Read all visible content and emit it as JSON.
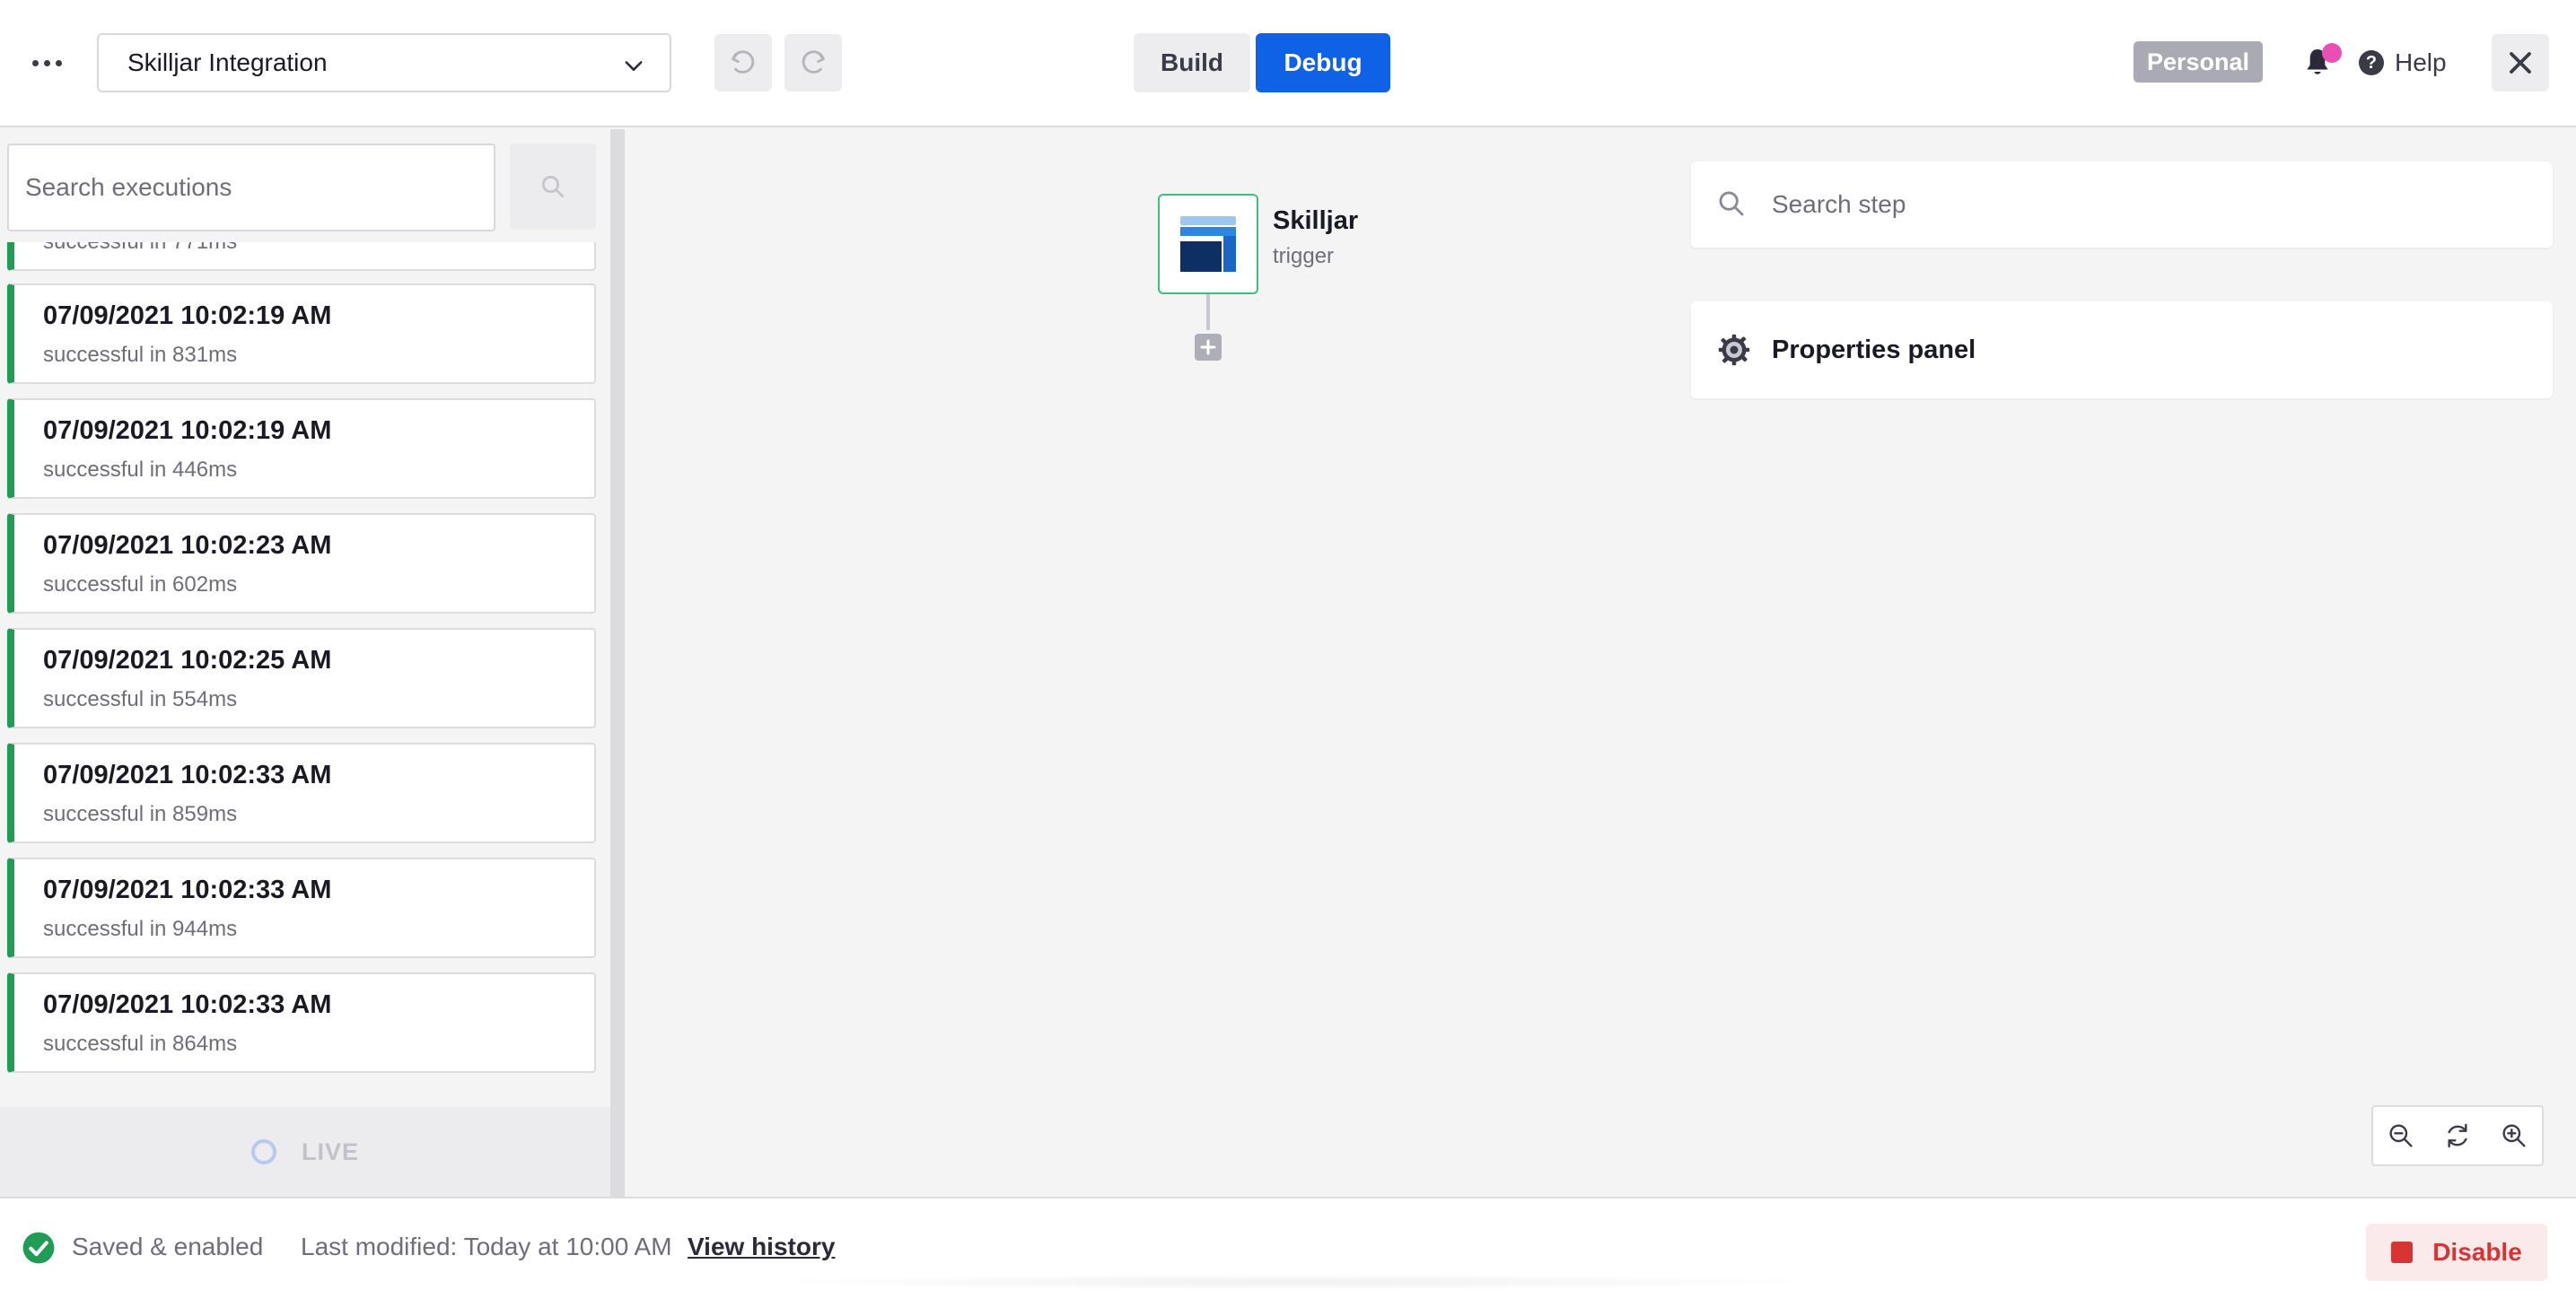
{
  "header": {
    "flow_name": "Skilljar Integration",
    "tabs": [
      {
        "label": "Build",
        "active": false
      },
      {
        "label": "Debug",
        "active": true
      }
    ],
    "workspace_badge": "Personal",
    "help_label": "Help",
    "notification_badge_color": "#ea4fb6",
    "accent_color": "#0f62e6"
  },
  "executions": {
    "search_placeholder": "Search executions",
    "partial_item_text": "successful in 771ms",
    "items": [
      {
        "time": "07/09/2021 10:02:19 AM",
        "status": "successful in 831ms"
      },
      {
        "time": "07/09/2021 10:02:19 AM",
        "status": "successful in 446ms"
      },
      {
        "time": "07/09/2021 10:02:23 AM",
        "status": "successful in 602ms"
      },
      {
        "time": "07/09/2021 10:02:25 AM",
        "status": "successful in 554ms"
      },
      {
        "time": "07/09/2021 10:02:33 AM",
        "status": "successful in 859ms"
      },
      {
        "time": "07/09/2021 10:02:33 AM",
        "status": "successful in 944ms"
      },
      {
        "time": "07/09/2021 10:02:33 AM",
        "status": "successful in 864ms"
      }
    ],
    "success_color": "#1f9d55",
    "live_label": "LIVE"
  },
  "canvas": {
    "trigger": {
      "name": "Skilljar",
      "type": "trigger"
    },
    "search_step_placeholder": "Search step",
    "properties_panel_label": "Properties panel"
  },
  "footer": {
    "status": "Saved & enabled",
    "last_modified": "Last modified: Today at 10:00 AM",
    "view_history": "View history",
    "disable_label": "Disable",
    "danger_color": "#d83434"
  }
}
